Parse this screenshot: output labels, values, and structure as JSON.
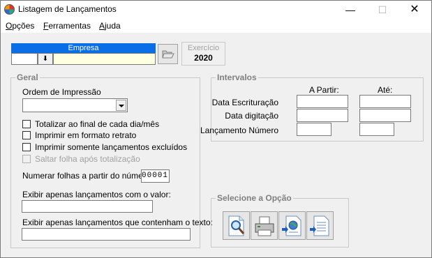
{
  "window": {
    "title": "Listagem de Lançamentos",
    "minimize_glyph": "—",
    "maximize_glyph": "☐",
    "close_glyph": "✕"
  },
  "menu": [
    {
      "label": "Opções",
      "mnemonic": "O",
      "rest": "pções"
    },
    {
      "label": "Ferramentas",
      "mnemonic": "F",
      "rest": "erramentas"
    },
    {
      "label": "Ajuda",
      "mnemonic": "A",
      "rest": "juda"
    }
  ],
  "empresa": {
    "label": "Empresa",
    "code": "",
    "name": "",
    "dropdown_glyph": "⬇"
  },
  "exercicio": {
    "label": "Exercício",
    "value": "2020"
  },
  "geral": {
    "title": "Geral",
    "ordem_label": "Ordem de Impressão",
    "ordem_value": "",
    "checkboxes": [
      {
        "label": "Totalizar ao final de cada dia/mês",
        "checked": false,
        "enabled": true
      },
      {
        "label": "Imprimir em formato retrato",
        "checked": false,
        "enabled": true
      },
      {
        "label": "Imprimir somente lançamentos excluídos",
        "checked": false,
        "enabled": true
      },
      {
        "label": "Saltar folha após totalização",
        "checked": false,
        "enabled": false
      }
    ],
    "numerar_label": "Numerar folhas a partir do número",
    "numerar_value": "00001",
    "valor_label": "Exibir apenas lançamentos com o valor:",
    "valor_value": "",
    "texto_label": "Exibir apenas lançamentos que contenham o texto:",
    "texto_value": ""
  },
  "intervalos": {
    "title": "Intervalos",
    "col_from": "A Partir:",
    "col_to": "Até:",
    "rows": [
      {
        "label": "Data Escrituração",
        "from": "",
        "to": ""
      },
      {
        "label": "Data digitação",
        "from": "",
        "to": ""
      },
      {
        "label": "Lançamento Número",
        "from": "",
        "to": ""
      }
    ]
  },
  "opcao": {
    "title": "Selecione a Opção",
    "buttons": [
      {
        "icon": "preview-icon"
      },
      {
        "icon": "printer-icon"
      },
      {
        "icon": "export-web-icon"
      },
      {
        "icon": "export-document-icon"
      }
    ]
  }
}
